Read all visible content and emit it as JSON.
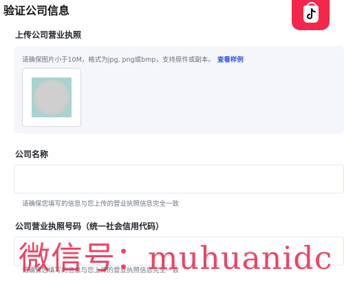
{
  "page": {
    "title": "验证公司信息"
  },
  "license_section": {
    "label": "上传公司营业执照",
    "hint": "请确保图片小于10M，格式为jpg, png或bmp，支持原件或副本。",
    "sample_link": "查看样例"
  },
  "company_name_section": {
    "label": "公司名称",
    "value": "",
    "hint": "请确保您填写的信息与您上传的营业执照信息完全一致"
  },
  "license_number_section": {
    "label": "公司营业执照号码（统一社会信用代码）",
    "value": "",
    "hint": "请确保您填写的信息与您上传的营业执照信息完全一致"
  },
  "watermark": {
    "text": "微信号：muhuanidc"
  },
  "colors": {
    "brand_red": "#f4264a",
    "link_blue": "#3b5bdb",
    "panel_bg": "#f5f6fa",
    "hint_gray": "#6b7280"
  },
  "icons": {
    "app_logo": "tiktok-shop-bag-icon"
  }
}
